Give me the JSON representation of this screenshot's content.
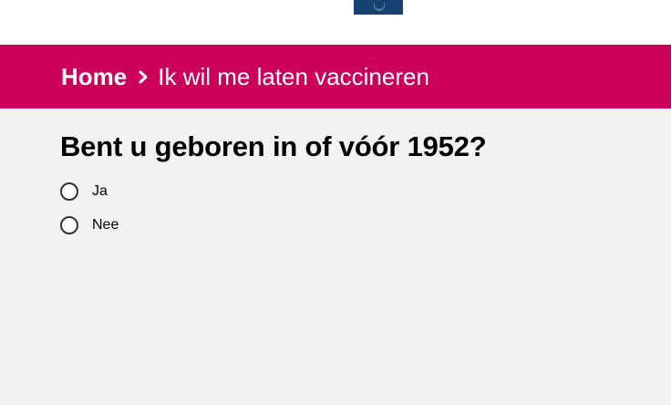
{
  "header": {
    "logo_icon": "rijksoverheid-logo-icon",
    "colors": {
      "logo_bg": "#154273",
      "breadcrumb_bg": "#cc005b",
      "page_bg": "#f2f2f2"
    }
  },
  "breadcrumb": {
    "home": "Home",
    "separator_icon": "chevron-right-icon",
    "current": "Ik wil me laten vaccineren"
  },
  "question": {
    "title": "Bent u geboren in of vóór 1952?",
    "options": [
      {
        "label": "Ja",
        "selected": false
      },
      {
        "label": "Nee",
        "selected": false
      }
    ]
  }
}
